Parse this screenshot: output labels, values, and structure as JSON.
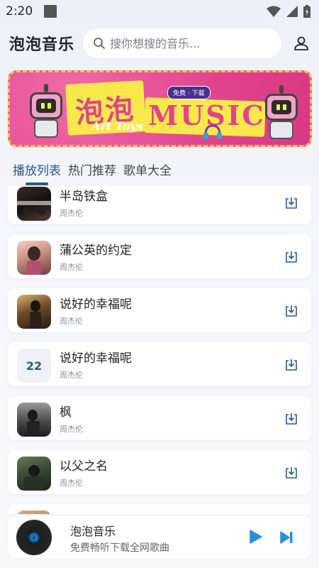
{
  "status_bar": {
    "time": "2:20"
  },
  "header": {
    "app_title": "泡泡音乐",
    "search_placeholder": "搜你想搜的音乐..."
  },
  "banner": {
    "title_cn": "泡泡",
    "title_en": "MUSIC",
    "tag": "免费 · 下载",
    "script": "Art Toys"
  },
  "tabs": [
    {
      "label": "播放列表",
      "active": true
    },
    {
      "label": "热门推荐",
      "active": false
    },
    {
      "label": "歌单大全",
      "active": false
    }
  ],
  "songs": [
    {
      "title": "半岛铁盒",
      "artist": "周杰伦",
      "cover": "album-art"
    },
    {
      "title": "蒲公英的约定",
      "artist": "周杰伦",
      "cover": "album-art"
    },
    {
      "title": "说好的幸福呢",
      "artist": "周杰伦",
      "cover": "album-art"
    },
    {
      "title": "说好的幸福呢",
      "artist": "周杰伦",
      "cover_number": "22"
    },
    {
      "title": "枫",
      "artist": "周杰伦",
      "cover": "album-art"
    },
    {
      "title": "以父之名",
      "artist": "周杰伦",
      "cover": "album-art"
    }
  ],
  "player": {
    "title": "泡泡音乐",
    "subtitle": "免费畅听下载全网歌曲"
  },
  "colors": {
    "accent": "#2a5a86",
    "play": "#2b8fd8",
    "banner": "#e0448c"
  }
}
